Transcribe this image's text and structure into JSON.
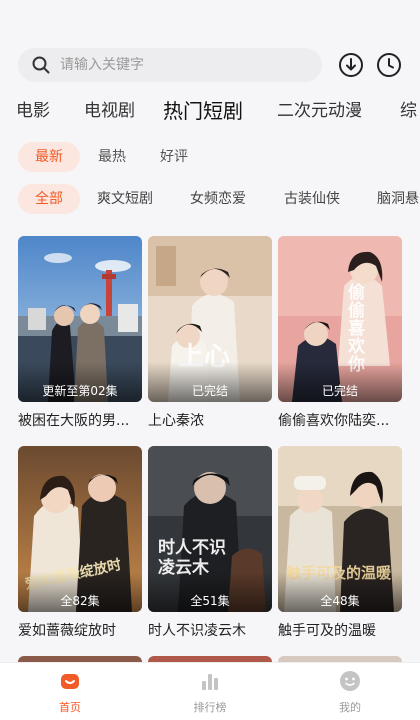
{
  "search": {
    "placeholder": "请输入关键字"
  },
  "top_icons": {
    "download": "download-icon",
    "history": "clock-icon"
  },
  "main_tabs": [
    "电影",
    "电视剧",
    "热门短剧",
    "二次元动漫",
    "综"
  ],
  "active_main_tab": "热门短剧",
  "sort_options": [
    "最新",
    "最热",
    "好评"
  ],
  "categories": [
    "全部",
    "爽文短剧",
    "女频恋爱",
    "古装仙侠",
    "脑洞悬"
  ],
  "videos": [
    {
      "title": "被困在大阪的男...",
      "status": "更新至第02集"
    },
    {
      "title": "上心秦浓",
      "status": "已完结",
      "art_text": "上心"
    },
    {
      "title": "偷偷喜欢你陆奕...",
      "status": "已完结",
      "art_text": "偷偷喜欢你"
    },
    {
      "title": "爱如蔷薇绽放时",
      "status": "全82集",
      "art_text": "爱如蔷薇绽放时"
    },
    {
      "title": "时人不识凌云木",
      "status": "全51集",
      "art_text": "时人不识凌云木"
    },
    {
      "title": "触手可及的温暖",
      "status": "全48集",
      "art_text": "触手可及的温暖"
    }
  ],
  "bottom_nav": [
    {
      "label": "首页",
      "icon": "home-icon"
    },
    {
      "label": "排行榜",
      "icon": "bar-chart-icon"
    },
    {
      "label": "我的",
      "icon": "user-face-icon"
    }
  ],
  "colors": {
    "accent": "#f25a28",
    "accent_bg": "#fbe7df"
  }
}
